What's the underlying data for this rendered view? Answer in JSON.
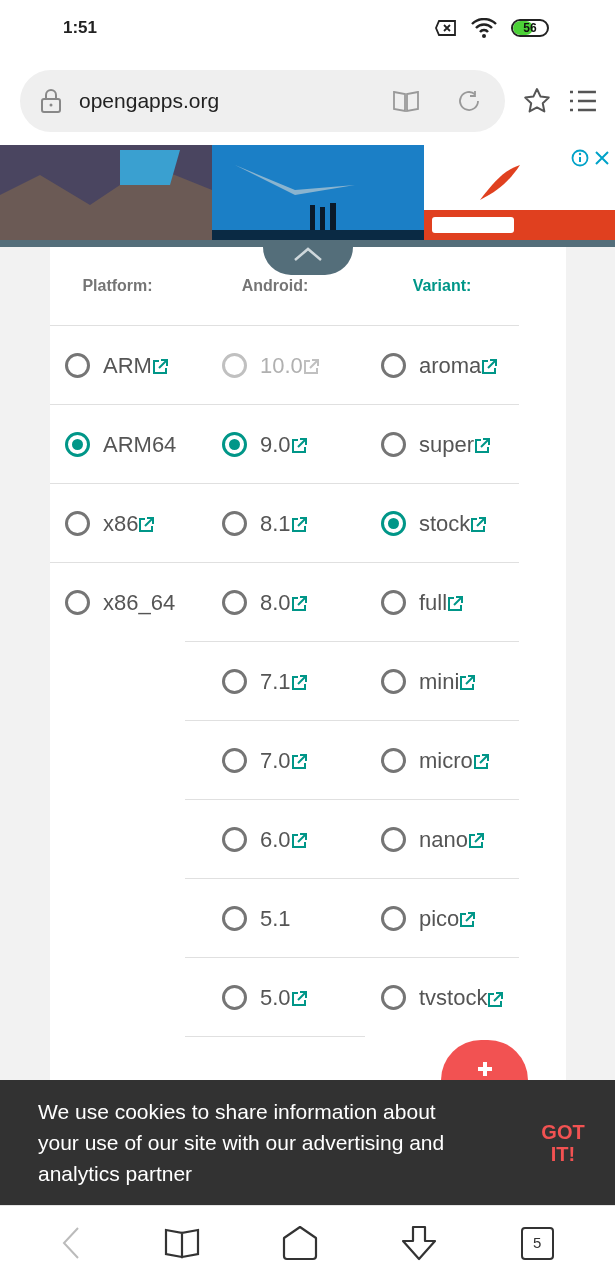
{
  "status_bar": {
    "time": "1:51",
    "battery": "56"
  },
  "address_bar": {
    "url": "opengapps.org"
  },
  "columns": [
    {
      "header": "Platform:",
      "selected": false,
      "options": [
        {
          "label": "ARM",
          "selected": false,
          "link": true
        },
        {
          "label": "ARM64",
          "selected": true,
          "link": false
        },
        {
          "label": "x86",
          "selected": false,
          "link": true
        },
        {
          "label": "x86_64",
          "selected": false,
          "link": false
        }
      ]
    },
    {
      "header": "Android:",
      "selected": false,
      "options": [
        {
          "label": "10.0",
          "selected": false,
          "link": true,
          "disabled": true
        },
        {
          "label": "9.0",
          "selected": true,
          "link": true,
          "disabled": false
        },
        {
          "label": "8.1",
          "selected": false,
          "link": true,
          "disabled": false
        },
        {
          "label": "8.0",
          "selected": false,
          "link": true,
          "disabled": false
        },
        {
          "label": "7.1",
          "selected": false,
          "link": true,
          "disabled": false
        },
        {
          "label": "7.0",
          "selected": false,
          "link": true,
          "disabled": false
        },
        {
          "label": "6.0",
          "selected": false,
          "link": true,
          "disabled": false
        },
        {
          "label": "5.1",
          "selected": false,
          "link": false,
          "disabled": false
        },
        {
          "label": "5.0",
          "selected": false,
          "link": true,
          "disabled": false
        }
      ]
    },
    {
      "header": "Variant:",
      "selected": true,
      "options": [
        {
          "label": "aroma",
          "selected": false,
          "link": true
        },
        {
          "label": "super",
          "selected": false,
          "link": true
        },
        {
          "label": "stock",
          "selected": true,
          "link": true
        },
        {
          "label": "full",
          "selected": false,
          "link": true
        },
        {
          "label": "mini",
          "selected": false,
          "link": true
        },
        {
          "label": "micro",
          "selected": false,
          "link": true
        },
        {
          "label": "nano",
          "selected": false,
          "link": true
        },
        {
          "label": "pico",
          "selected": false,
          "link": true
        },
        {
          "label": "tvstock",
          "selected": false,
          "link": true
        }
      ]
    }
  ],
  "cookie_notice": {
    "text": "We use cookies to share information about your use of our site with our advertising and analytics partner",
    "button": "GOT IT!"
  },
  "bottom_nav": {
    "tab_count": "5"
  }
}
